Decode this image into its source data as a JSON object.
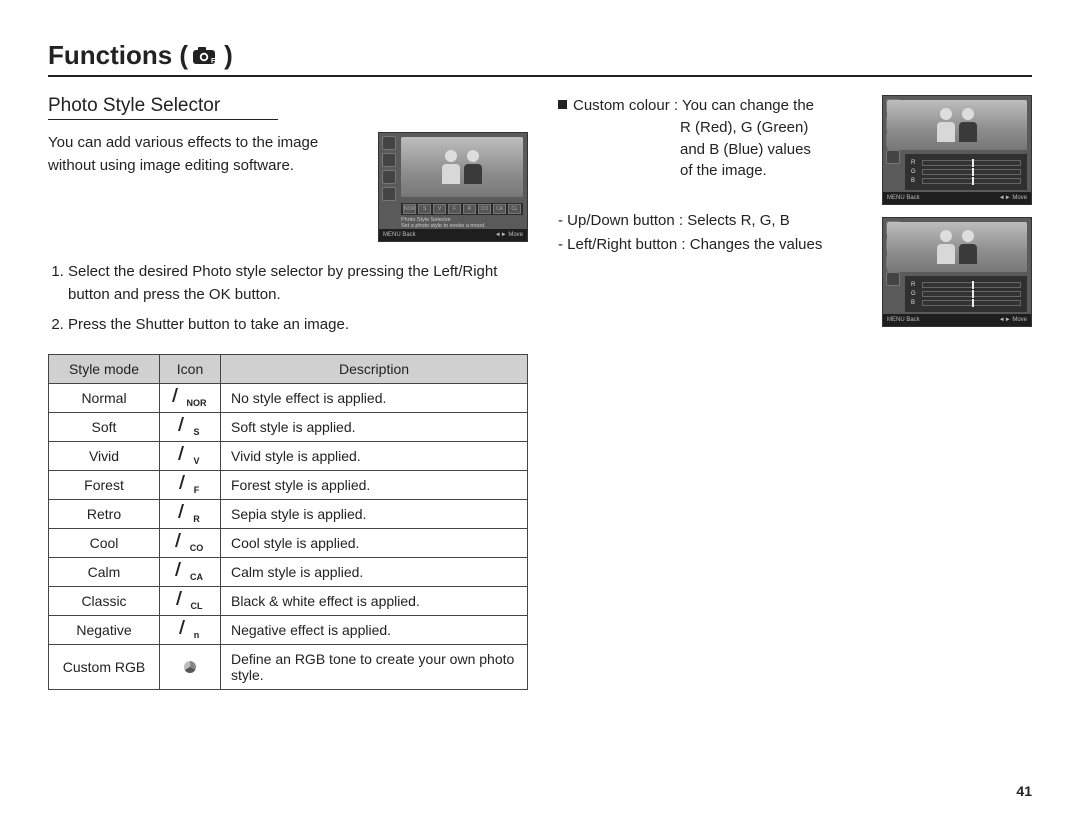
{
  "heading": "Functions (",
  "heading_close": ")",
  "subheading": "Photo Style Selector",
  "intro": "You can add various effects to the image without using image editing software.",
  "steps": [
    "Select the desired Photo style selector by pressing the Left/Right button and press the OK button.",
    "Press the Shutter button to take an image."
  ],
  "table": {
    "headers": [
      "Style mode",
      "Icon",
      "Description"
    ],
    "rows": [
      {
        "mode": "Normal",
        "icon_sub": "NOR",
        "icon_type": "pen",
        "desc": "No style effect is applied."
      },
      {
        "mode": "Soft",
        "icon_sub": "S",
        "icon_type": "pen",
        "desc": "Soft style is applied."
      },
      {
        "mode": "Vivid",
        "icon_sub": "V",
        "icon_type": "pen",
        "desc": "Vivid style is applied."
      },
      {
        "mode": "Forest",
        "icon_sub": "F",
        "icon_type": "pen",
        "desc": "Forest style is applied."
      },
      {
        "mode": "Retro",
        "icon_sub": "R",
        "icon_type": "pen",
        "desc": "Sepia style is applied."
      },
      {
        "mode": "Cool",
        "icon_sub": "CO",
        "icon_type": "pen",
        "desc": "Cool style is applied."
      },
      {
        "mode": "Calm",
        "icon_sub": "CA",
        "icon_type": "pen",
        "desc": "Calm style is applied."
      },
      {
        "mode": "Classic",
        "icon_sub": "CL",
        "icon_type": "pen",
        "desc": "Black & white effect is applied."
      },
      {
        "mode": "Negative",
        "icon_sub": "n",
        "icon_type": "pen",
        "desc": "Negative effect is applied."
      },
      {
        "mode": "Custom RGB",
        "icon_sub": "",
        "icon_type": "rgb",
        "desc": "Define an RGB tone to create your own photo style."
      }
    ]
  },
  "right": {
    "custom_label": "Custom colour",
    "custom_desc_first": ": You can change the",
    "custom_desc_lines": [
      "R (Red), G (Green)",
      "and B (Blue) values",
      "of the image."
    ],
    "dash1_label": "- Up/Down button",
    "dash1_rest": " : Selects R, G, B",
    "dash2_label": "- Left/Right button",
    "dash2_rest": " : Changes the values"
  },
  "shot1": {
    "strip_icons": [
      "NOR",
      "S",
      "V",
      "F",
      "R",
      "CO",
      "CA",
      "CL"
    ],
    "line1": "Photo Style Selector",
    "line2": "Set a photo style to evoke a mood.",
    "bottom_left": "MENU  Back",
    "bottom_right": "◄►  Move"
  },
  "shot_rgb": {
    "sliders": [
      "R",
      "G",
      "B"
    ],
    "bottom_left": "MENU  Back",
    "bottom_right": "◄►  Move"
  },
  "page_number": "41"
}
